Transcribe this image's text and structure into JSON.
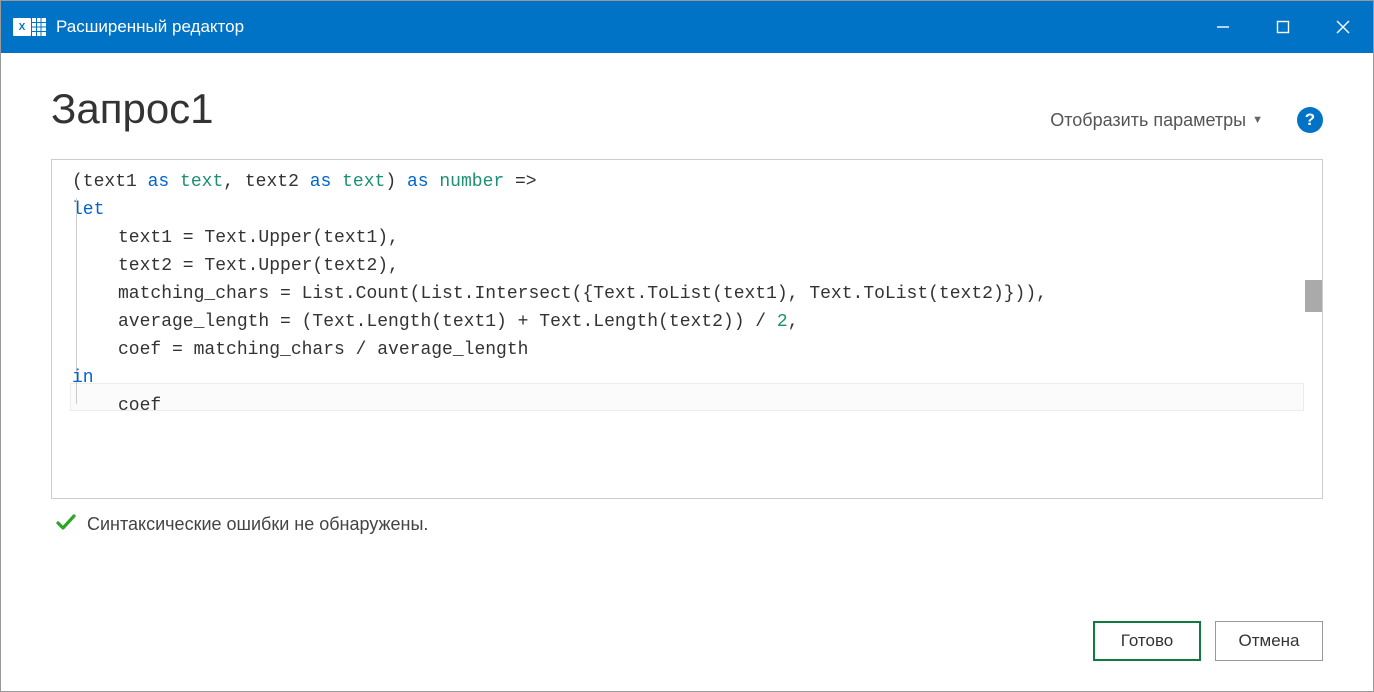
{
  "titlebar": {
    "app_badge": "X",
    "title": "Расширенный редактор"
  },
  "header": {
    "query_title": "Запрос1",
    "display_params": "Отобразить параметры"
  },
  "code": {
    "l1_p1": "(text1 ",
    "l1_as1": "as",
    "l1_sp1": " ",
    "l1_type1": "text",
    "l1_p2": ", text2 ",
    "l1_as2": "as",
    "l1_sp2": " ",
    "l1_type2": "text",
    "l1_p3": ") ",
    "l1_as3": "as",
    "l1_sp3": " ",
    "l1_type3": "number",
    "l1_p4": " =>",
    "l2_let": "let",
    "l3": "text1 = Text.Upper(text1),",
    "l4": "text2 = Text.Upper(text2),",
    "l5": "matching_chars = List.Count(List.Intersect({Text.ToList(text1), Text.ToList(text2)})),",
    "l6_a": "average_length = (Text.Length(text1) + Text.Length(text2)) / ",
    "l6_num": "2",
    "l6_b": ",",
    "l7": "coef =  matching_chars / average_length",
    "l8_in": "in",
    "l9": "coef"
  },
  "status": {
    "text": "Синтаксические ошибки не обнаружены."
  },
  "buttons": {
    "ok": "Готово",
    "cancel": "Отмена"
  }
}
